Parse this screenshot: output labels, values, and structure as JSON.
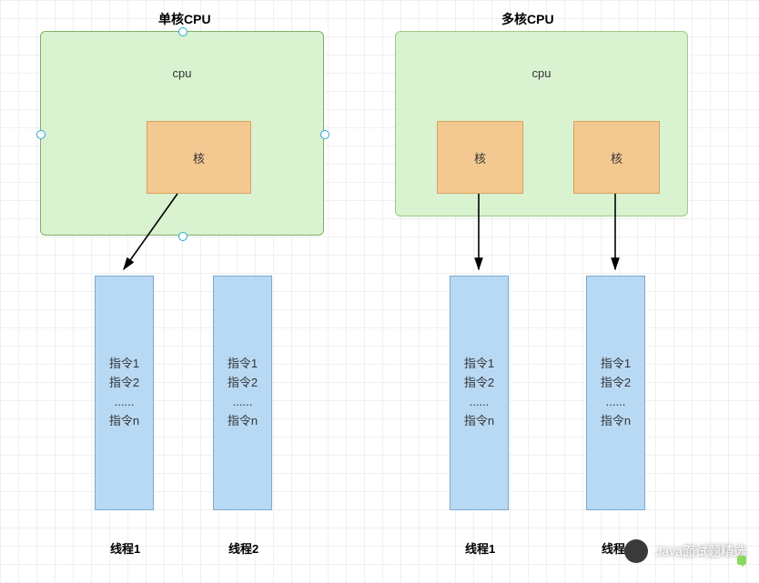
{
  "titles": {
    "single": "单核CPU",
    "multi": "多核CPU"
  },
  "cpu_label": "cpu",
  "core_label": "核",
  "threads": {
    "t1_lines": [
      "指令1",
      "指令2",
      "......",
      "指令n"
    ],
    "t2_lines": [
      "指令1",
      "指令2",
      "......",
      "指令n"
    ],
    "t3_lines": [
      "指令1",
      "指令2",
      "......",
      "指令n"
    ],
    "t4_lines": [
      "指令1",
      "指令2",
      "......",
      "指令n"
    ],
    "label1": "线程1",
    "label2": "线程2",
    "label3": "线程1",
    "label4": "线程2"
  },
  "watermark": "Java面试题精选"
}
